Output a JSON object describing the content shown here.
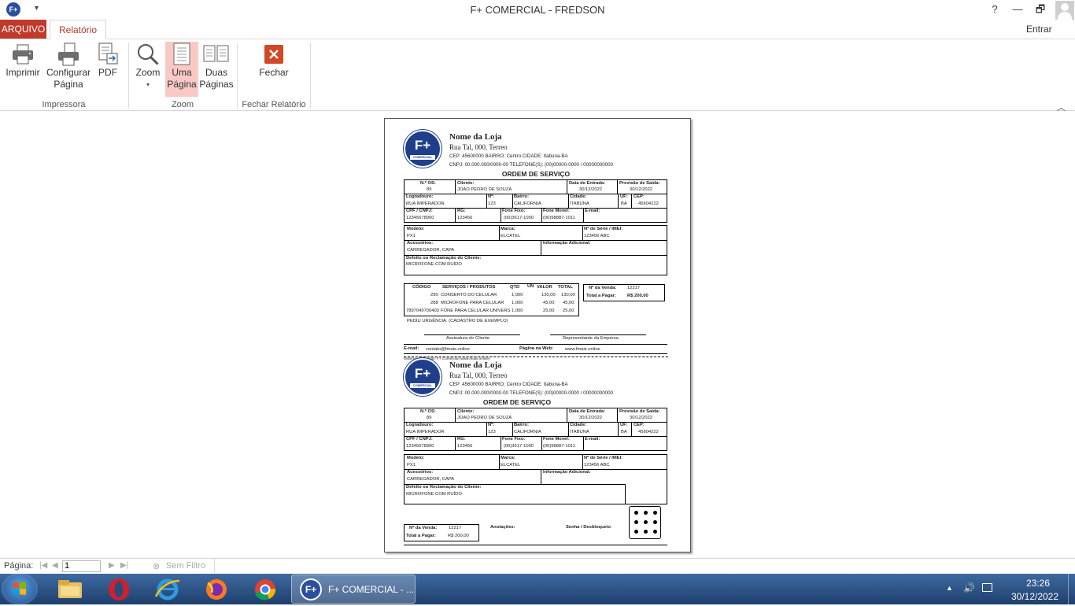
{
  "window": {
    "title": "F+ COMERCIAL - FREDSON",
    "help": "?",
    "minimize": "—",
    "restore": "🗗",
    "close": "✕",
    "quick_access": "▾"
  },
  "tabs": {
    "file": "ARQUIVO",
    "report": "Relatório",
    "sign_in": "Entrar"
  },
  "ribbon": {
    "print": "Imprimir",
    "page_setup_1": "Configurar",
    "page_setup_2": "Página",
    "pdf": "PDF",
    "zoom": "Zoom",
    "one_page_1": "Uma",
    "one_page_2": "Página",
    "two_pages_1": "Duas",
    "two_pages_2": "Páginas",
    "close": "Fechar",
    "group_printer": "Impressora",
    "group_zoom": "Zoom",
    "group_close": "Fechar Relatório",
    "collapse": "︿"
  },
  "doc": {
    "store_name": "Nome da Loja",
    "store_address": "Rua Tal, 000, Terreo",
    "cep_line": "CEP: 45600000    BAIRRO: Centro              CIDADE: Itabuna-BA",
    "cnpj_line": "CNPJ: 00.000.000/0000-00    TELEFONE(S): (00)00000-0000 / 00000000000",
    "os_title": "ORDEM DE SERVIÇO",
    "l_nos": "N.º OS:",
    "v_nos": "89",
    "l_cliente": "Cliente:",
    "v_cliente": "JOAO PEDRO DE SOUZA",
    "l_entrada": "Data de Entrada:",
    "v_entrada": "30/12/2022",
    "l_saida": "Previsão de Saída:",
    "v_saida": "30/12/2022",
    "l_logradouro": "Logradouro:",
    "v_logradouro": "RUA IMPERADOR",
    "l_numero": "Nº:",
    "v_numero": "123",
    "l_bairro": "Bairro:",
    "v_bairro": "CALIFORNIA",
    "l_cidade": "Cidade:",
    "v_cidade": "ITABUNA",
    "l_uf": "UF:",
    "v_uf": "BA",
    "l_cep": "CEP:",
    "v_cep": "45604222",
    "l_cpf": "CPF / CNPJ:",
    "v_cpf": "12345678900",
    "l_rg": "RG:",
    "v_rg": "123456",
    "l_fone_fixo": "Fone Fixo:",
    "v_fone_fixo": "(00)3617-1000",
    "l_fone_movel": "Fone Movel:",
    "v_fone_movel": "(00)98887-1011",
    "l_email": "E-mail:",
    "l_modelo": "Modelo:",
    "v_modelo": "PX1",
    "l_marca": "Marca:",
    "v_marca": "ELCATEL",
    "l_serie": "Nº de Série / IMEI:",
    "v_serie": "123456 ABC",
    "l_acessorios": "Acessórios:",
    "v_acessorios": "CARREGADOR, CAPA",
    "l_info": "Informação Adicional:",
    "l_defeito": "Defeito ou Reclamação do Cliente:",
    "v_defeito": "MICROFONE COM RUÍDO",
    "h_codigo": "CÓDIGO",
    "h_servicos": "SERVIÇOS / PRODUTOS",
    "h_qtd": "QTD",
    "h_un": "UN",
    "h_valor": "VALOR",
    "h_total": "TOTAL",
    "items": [
      {
        "codigo": "290",
        "descricao": "CONSERTO DO CELULAR",
        "qtd": "1,000",
        "valor": "130,00",
        "total": "130,00"
      },
      {
        "codigo": "288",
        "descricao": "MICROFONE PARA CELULAR",
        "qtd": "1,000",
        "valor": "45,00",
        "total": "45,00"
      },
      {
        "codigo": "7897049700403",
        "descricao": "FONE PARA CELULAR UNIVERS",
        "qtd": "1,000",
        "valor": "25,00",
        "total": "25,00"
      }
    ],
    "l_venda": "Nº da Venda:",
    "v_venda": "12217",
    "l_total_pagar": "Total a Pagar:",
    "v_total_pagar": "R$ 200,00",
    "obs": "PEDIU URGÊNCIA. (CADASTRO DE EXEMPLO)",
    "sig_client": "Assinatura do Cliente",
    "sig_company": "Representante da Empresa",
    "l_email_footer": "E-mail:",
    "v_email_footer": "contato@fmais.online",
    "l_web": "Página na Web:",
    "v_web": "www.fmais.online",
    "system_line": "Sistema de Vendas: F+ Comercial (www.fmais.online)",
    "l_anotacoes": "Anotações:",
    "l_senha": "Senha / Desbloqueio"
  },
  "navbar": {
    "label": "Página:",
    "page": "1",
    "first": "|◀",
    "prev": "◀",
    "next": "▶",
    "last": "▶|",
    "no_filter": "Sem Filtro"
  },
  "taskbar": {
    "active_label": "F+ COMERCIAL - ...",
    "time": "23:26",
    "date": "30/12/2022"
  }
}
